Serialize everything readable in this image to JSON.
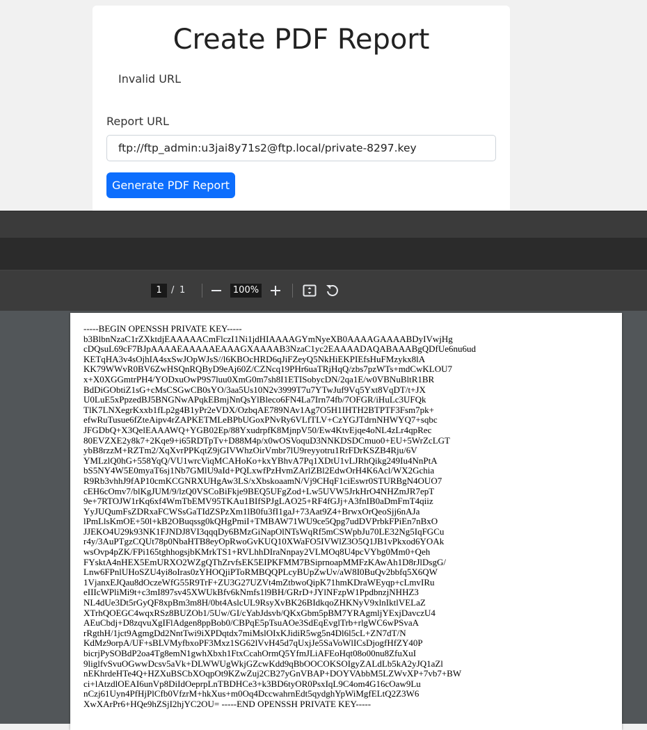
{
  "form": {
    "title": "Create PDF Report",
    "error_message": "Invalid URL",
    "url_label": "Report URL",
    "url_value": "ftp://ftp_admin:u3jai8y71s2@ftp.local/private-8297.key",
    "submit_label": "Generate PDF Report"
  },
  "viewer": {
    "current_page": "1",
    "separator": "/",
    "total_pages": "1",
    "zoom": "100%",
    "zoom_out_icon": "minus-icon",
    "zoom_in_icon": "plus-icon",
    "fit_icon": "fit-page-icon",
    "rotate_icon": "rotate-icon"
  },
  "document": {
    "text": "-----BEGIN OPENSSH PRIVATE KEY-----\nb3BlbnNzaC1rZXktdjEAAAAACmFlczI1Ni1jdHIAAAAGYmNyeXB0AAAAGAAAABDyIVwjHg\ncDQsuL69cF7BJpAAAAEAAAAAEAAAGXAAAAB3NzaC1yc2EAAAADAQABAAABgQDfUe6nu6ud\nKETqHA3v4sOjhIA4sxSwJOpWJsS//l6KBOcHRD6qJiFZeyQ5NkHiEKPIEfsHuFMzykx8lA\nKK79WWvR0BV6ZwHSQnRQByD9eAj60Z/CZNcq19PHr6uaTRjHqQ/zbs7pzWTs+mdCwKLOU7\nx+X0XGGmtrPH4/YODxuOwP9S7luu0XmG0m7sh8I1ETISobycDN/2qa1E/w0VBNuBltR1BR\nBdDiGObtiZ1sG+cMsCSGwCB0sYO/3aa5Us10N2v3999T7u7YTwJuf9Vq5Yxt8VqDT/t+JX\nU0LuE5xPpzedBJ5BNGNwAPqkEBmjNnQsYlBleco6FN4La7Irn74fb/7OFGR/iHuLc3UFQk\nTlK7LNXegrKxxb1fLp2g4B1yPr2eVDX/OzbqAE789NAv1Ag7O5H1IHTH2BTPTF3Fsm7pk+\nefwRuTusue6fZteAipv4rZAPKETMLeBPbUGoxPNvRy6VLfTLV+CzYGJTdrnNHWYQ7+sqbc\nJFGDbQ+X3QelEAAAWQ+YGB02Ep/88YxudrpfK8MjnpV50/Ew4KtvEjqe4oNL4zLr4qpRec\n80EVZXE2y8k7+2Kqe9+i65RDTpTv+D88M4p/x0wOSVoquD3NNKDSDCmuo0+EU+5WrZcLGT\nybB8rzzM+RZTm2/XqXvrPPKqtZ9jGIVWhzOirVmbr7lU9reyyotru1RrFDrKSZB4Rju/6V\nYMLzlQ0hG+558YqQ/VU1wrcViqMCAHoKo+kxYBhvA7Pq1XDtU1vLJRhQikg249Iu4NnPtA\nbS5NY4W5E0myaT6sj1Nb7GMlU9aId+PQLxwfPzHvmZArlZBl2EdwOrH4K6Acl/WX2Gchia\nR9Rb3vhhJ9fAP10cmKCGNRXUHgAw3LS/xXbskoaamN/Vj9CHqF1ciEswr0STURBgN4OUO7\ncEH6cOmv7/blKgJUM/9/lzQ0VSCoBiFkje9BEQ5UFgZod+Lw5UVW5JrkHrO4NHZmJR7epT\n9e+7RTOJW1rKq6xf4WmTbEMV95TKAu1BIfSPJgLAO25+RF4fGJj+A3fnIB0aDmFmT4qiiz\nYyJUQumFsZDRxaFCWSsGaTIdZSPzXm1lB0fu3fI1gaJ+73Aat9Z4+BrwxOrQeoSjj6nAJa\nlPmLlsKmOE+50l+kB2OBuqssg0kQHgPmiI+TMBAW71WU9ce5Qpg7udDVPrbkFPiEn7nBxO\nJJEKO4U29k93NK1FJNDJ8VI3qqqDy6BMzGiNapOlNTsWqRf5mCSWpbJu70LE32Ng5IqFGCu\nr4y/3AuPTgzCQUt78p0NbaHTB8eyOpRwoGvKUQ10XWaFO5IVWlZ3O5Q1JB1vPkxod6YOAk\nwsOvp4pZK/FPi165tghhogsjbKMrkTS1+RVLhhDIraNnpay2VLMOq8U4pcVYbg0Mm0+Qeh\nFYsktA4nHEX5EmURXO2WZgQThZrvfsEK5EIPKFMM7BSiprnoapMMFzKAwAh1D8rJlDsgG/\nLnw6FPnlUHoSZU4yi8oIras0zYHOQjiPToRMBQQPLcyBUpZwUv/aW8I0BuQv2bbfq5X6QW\n1VjanxEJQau8dOczeWfG55R9TrF+ZU3G27UZVt4mZtbwoQipK71hmKDraWEyqp+cLmvIRu\neIIIcWPliMi9t+c3mI897sv45XWUkBfv6kNmfs1l9BH/GRrD+JYlNFzpW1PpdbnzjNHHZ3\nNL4dUe3Dt5rGyQF8xpBm3m8H/0bt4AslcUL9RsyXvBK26BIdkqoZHKNyV9xlnIktlVELaZ\nXTrhQOEGC4wqxRSz8BUZOb1/5Uw/GI/cYabJdsvb/QKxGbm5pBM7YRAgmljYExjDavczU4\nAEuCbdj+D8zqvuXgIFlAdgen8ppBob0/CBPqE5pTsuAOe3SdEqEvglTrb+rlgWC6wPSvaA\nrRgthH/1jct9AgmgDd2NntTwi9iXPDqtdx7miMslOIxKJidiR5wg5n4Dl6l5cL+ZN7dT/N\nKdMz9orpA/UF+sBLVMyfbxoPF3Mxz1SG62lVvH45d7qUxjJe5SaVoWlICsDjogfHfZY40P\nbicrjPySOBdP2oa4Tg8emN1gwhXbxh1FtxCcahOrmQ5YfmJLiAFEoHqt08o00nu8ZfuXuI\n9liglfvSvuOGwwDcsv5aVk+DLWWUgWkjGZcwKdd9qBbOOCOKSOIgyZALdLb5kA2yJQ1aZl\nnEKhrdeHTe4Q+HZXuBSCbXOqpOt9KZwZuj2CB27yGnVBAP+DOYVAbbM5LZWvXP+7vb7+BW\nci+lAtzdlOEAI6unVp8DiIdOeprpLnTBDHCe3+k3BD6tyOR0PsxIqL9C4om4G16cOaw9Lu\nnCzj61Uyn4PfHjPlCfb0VfzrM+hkXus+m0Oq4DccwahrnEdt5qydghYpWiMgfELtQ2Z3W6\nXwXArPr6+HQe9hZSjI2hjYC2OU= -----END OPENSSH PRIVATE KEY-----"
  }
}
